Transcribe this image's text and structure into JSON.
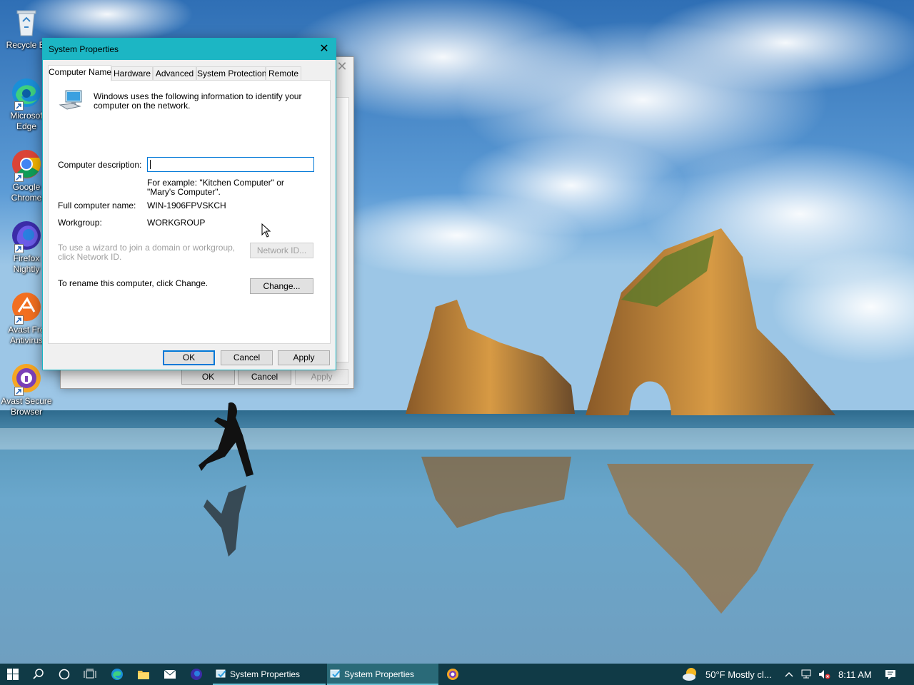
{
  "desktop": {
    "icons": [
      {
        "label": "Recycle Bi",
        "icon": "recycle-bin-icon"
      },
      {
        "label": "Microsof\nEdge",
        "icon": "edge-icon"
      },
      {
        "label": "Google\nChrome",
        "icon": "chrome-icon"
      },
      {
        "label": "Firefox\nNightly",
        "icon": "firefox-nightly-icon"
      },
      {
        "label": "Avast Fre\nAntivirus",
        "icon": "avast-antivirus-icon"
      },
      {
        "label": "Avast Secure\nBrowser",
        "icon": "avast-secure-browser-icon"
      }
    ]
  },
  "back_window": {
    "buttons": {
      "ok": "OK",
      "cancel": "Cancel",
      "apply": "Apply"
    }
  },
  "dialog": {
    "title": "System Properties",
    "close_icon": "close-icon",
    "tabs": [
      {
        "label": "Computer Name",
        "active": true
      },
      {
        "label": "Hardware",
        "active": false
      },
      {
        "label": "Advanced",
        "active": false
      },
      {
        "label": "System Protection",
        "active": false
      },
      {
        "label": "Remote",
        "active": false
      }
    ],
    "computer_name": {
      "intro": "Windows uses the following information to identify your computer on the network.",
      "description_label": "Computer description:",
      "description_value": "",
      "example": "For example: \"Kitchen Computer\" or \"Mary's Computer\".",
      "full_name_label": "Full computer name:",
      "full_name_value": "WIN-1906FPVSKCH",
      "workgroup_label": "Workgroup:",
      "workgroup_value": "WORKGROUP",
      "network_id_text": "To use a wizard to join a domain or workgroup, click Network ID.",
      "network_id_button": "Network ID...",
      "rename_text": "To rename this computer, click Change.",
      "change_button": "Change..."
    },
    "buttons": {
      "ok": "OK",
      "cancel": "Cancel",
      "apply": "Apply"
    }
  },
  "taskbar": {
    "apps": [
      {
        "label": "System Properties",
        "active": false
      },
      {
        "label": "System Properties",
        "active": true
      }
    ],
    "weather": "50°F  Mostly cl...",
    "time": "8:11 AM"
  },
  "colors": {
    "titlebar": "#1cb6c4",
    "taskbar": "#103a46",
    "focus": "#0078d7"
  }
}
